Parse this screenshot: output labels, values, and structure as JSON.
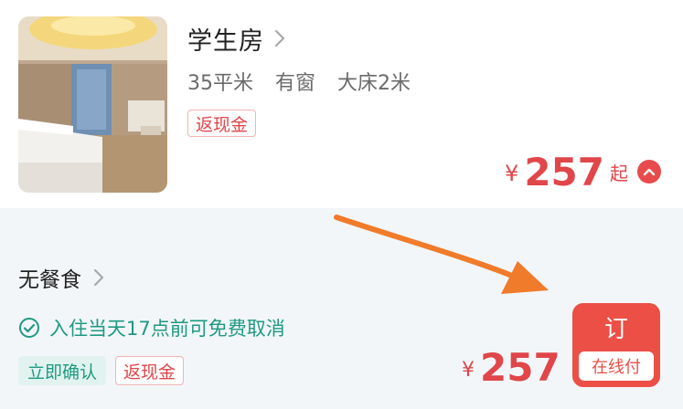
{
  "room": {
    "name": "学生房",
    "features": [
      "35平米",
      "有窗",
      "大床2米"
    ],
    "tags": [
      "返现金"
    ],
    "price_symbol": "¥",
    "price": "257",
    "price_suffix": "起"
  },
  "rate_plan": {
    "name": "无餐食",
    "cancel_policy": "入住当天17点前可免费取消",
    "tags": {
      "confirm": "立即确认",
      "cashback": "返现金"
    },
    "price_symbol": "¥",
    "price": "257",
    "book_label": "订",
    "pay_label": "在线付"
  },
  "colors": {
    "price_red": "#e0464a",
    "book_button": "#ec4f46",
    "policy_green": "#1e9a83",
    "annotation_arrow": "#f07b2a"
  },
  "icons": {
    "room_chevron": "chevron-right-icon",
    "collapse": "chevron-up-icon",
    "rate_chevron": "chevron-right-icon",
    "cancel_check": "check-circle-icon"
  }
}
